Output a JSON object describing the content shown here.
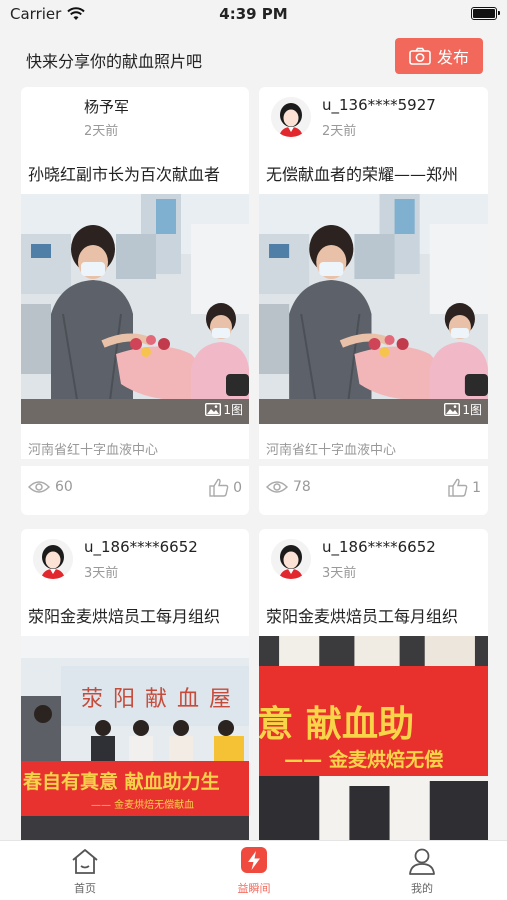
{
  "status_bar": {
    "carrier": "Carrier",
    "time": "4:39 PM"
  },
  "header": {
    "title": "快来分享你的献血照片吧",
    "publish_label": "发布",
    "accent": "#f2685a"
  },
  "cards": [
    {
      "username": "杨予军",
      "time": "2天前",
      "title": "孙晓红副市长为百次献血者",
      "photo_count": "1图",
      "org": "河南省红十字血液中心",
      "views": "60",
      "likes": "0"
    },
    {
      "username": "u_136****5927",
      "time": "2天前",
      "title": "无偿献血者的荣耀——郑州",
      "photo_count": "1图",
      "org": "河南省红十字血液中心",
      "views": "78",
      "likes": "1"
    },
    {
      "username": "u_186****6652",
      "time": "3天前",
      "title": "荥阳金麦烘焙员工每月组织",
      "banner_text": "春自有真意  献血助力生",
      "banner_sub": "—— 金麦烘焙无偿献血",
      "wall_sign": "荥阳献血屋"
    },
    {
      "username": "u_186****6652",
      "time": "3天前",
      "title": "荥阳金麦烘焙员工每月组织",
      "banner_text": "意  献血助",
      "banner_sub": "—— 金麦烘焙无偿"
    }
  ],
  "tabbar": {
    "items": [
      {
        "label": "首页",
        "icon": "home-icon",
        "active": false
      },
      {
        "label": "益瞬间",
        "icon": "lightning-icon",
        "active": true
      },
      {
        "label": "我的",
        "icon": "profile-icon",
        "active": false
      }
    ]
  }
}
